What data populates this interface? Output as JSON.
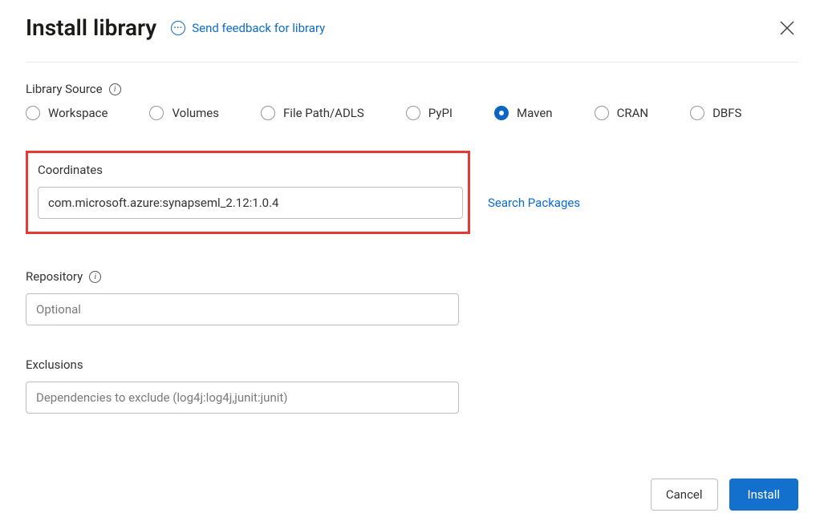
{
  "header": {
    "title": "Install library",
    "feedback_label": "Send feedback for library"
  },
  "library_source": {
    "label": "Library Source",
    "options": [
      {
        "label": "Workspace",
        "selected": false
      },
      {
        "label": "Volumes",
        "selected": false
      },
      {
        "label": "File Path/ADLS",
        "selected": false
      },
      {
        "label": "PyPI",
        "selected": false
      },
      {
        "label": "Maven",
        "selected": true
      },
      {
        "label": "CRAN",
        "selected": false
      },
      {
        "label": "DBFS",
        "selected": false
      }
    ]
  },
  "coordinates": {
    "label": "Coordinates",
    "value": "com.microsoft.azure:synapseml_2.12:1.0.4",
    "search_packages_label": "Search Packages"
  },
  "repository": {
    "label": "Repository",
    "placeholder": "Optional",
    "value": ""
  },
  "exclusions": {
    "label": "Exclusions",
    "placeholder": "Dependencies to exclude (log4j:log4j,junit:junit)",
    "value": ""
  },
  "footer": {
    "cancel_label": "Cancel",
    "install_label": "Install"
  }
}
